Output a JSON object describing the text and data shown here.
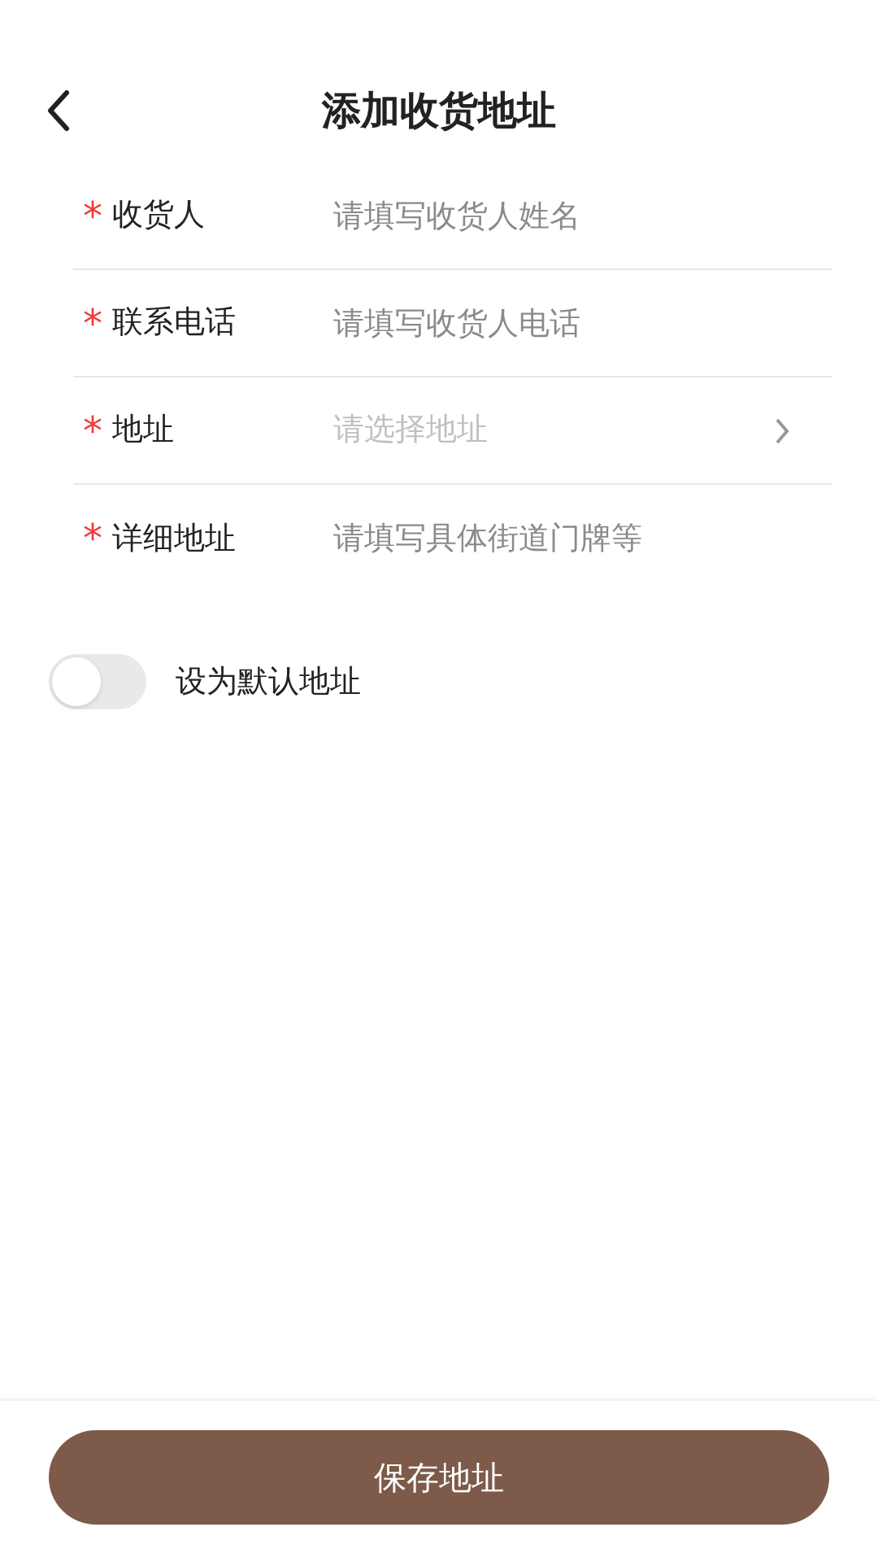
{
  "header": {
    "title": "添加收货地址"
  },
  "fields": [
    {
      "kind": "input",
      "required": "*",
      "label": "收货人",
      "placeholder": "请填写收货人姓名"
    },
    {
      "kind": "input",
      "required": "*",
      "label": "联系电话",
      "placeholder": "请填写收货人电话"
    },
    {
      "kind": "select",
      "required": "*",
      "label": "地址",
      "placeholder": "请选择地址"
    },
    {
      "kind": "input",
      "required": "*",
      "label": "详细地址",
      "placeholder": "请填写具体街道门牌等"
    }
  ],
  "default_toggle": {
    "label": "设为默认地址",
    "on": false
  },
  "save_button": "保存地址"
}
